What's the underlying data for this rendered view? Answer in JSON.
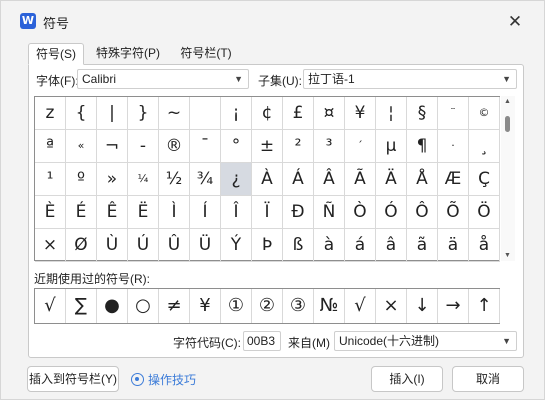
{
  "window": {
    "title": "符号",
    "app_icon": "W",
    "close_glyph": "✕"
  },
  "tabs": [
    {
      "label": "符号(S)",
      "active": true
    },
    {
      "label": "特殊字符(P)",
      "active": false
    },
    {
      "label": "符号栏(T)",
      "active": false
    }
  ],
  "font_row": {
    "font_label": "字体(F):",
    "font_value": "Calibri",
    "subset_label": "子集(U):",
    "subset_value": "拉丁语-1"
  },
  "symbol_grid": {
    "selected_index": 36,
    "small_indices": [
      13,
      14,
      16,
      25,
      28,
      33
    ],
    "cells": [
      "z",
      "{",
      "|",
      "}",
      "~",
      "",
      "¡",
      "¢",
      "£",
      "¤",
      "¥",
      "¦",
      "§",
      "¨",
      "©",
      "ª",
      "«",
      "¬",
      "-",
      "®",
      "¯",
      "°",
      "±",
      "²",
      "³",
      "´",
      "µ",
      "¶",
      "·",
      "¸",
      "¹",
      "º",
      "»",
      "¼",
      "½",
      "¾",
      "¿",
      "À",
      "Á",
      "Â",
      "Ã",
      "Ä",
      "Å",
      "Æ",
      "Ç",
      "È",
      "É",
      "Ê",
      "Ë",
      "Ì",
      "Í",
      "Î",
      "Ï",
      "Ð",
      "Ñ",
      "Ò",
      "Ó",
      "Ô",
      "Õ",
      "Ö",
      "×",
      "Ø",
      "Ù",
      "Ú",
      "Û",
      "Ü",
      "Ý",
      "Þ",
      "ß",
      "à",
      "á",
      "â",
      "ã",
      "ä",
      "å"
    ]
  },
  "recent": {
    "label": "近期使用过的符号(R):",
    "symbols": [
      "√",
      "∑",
      "●",
      "○",
      "≠",
      "¥",
      "①",
      "②",
      "③",
      "№",
      "√",
      "×",
      "↓",
      "→",
      "↑"
    ]
  },
  "code_row": {
    "code_label": "字符代码(C):",
    "code_value": "00B3",
    "from_label": "来自(M)",
    "from_value": "Unicode(十六进制)"
  },
  "footer": {
    "insert_to_bar": "插入到符号栏(Y)",
    "tips": "操作技巧",
    "insert": "插入(I)",
    "cancel": "取消"
  },
  "colors": {
    "accent": "#3b7bd8",
    "app_icon": "#2b62d9",
    "selected_cell": "#d6dae1"
  }
}
